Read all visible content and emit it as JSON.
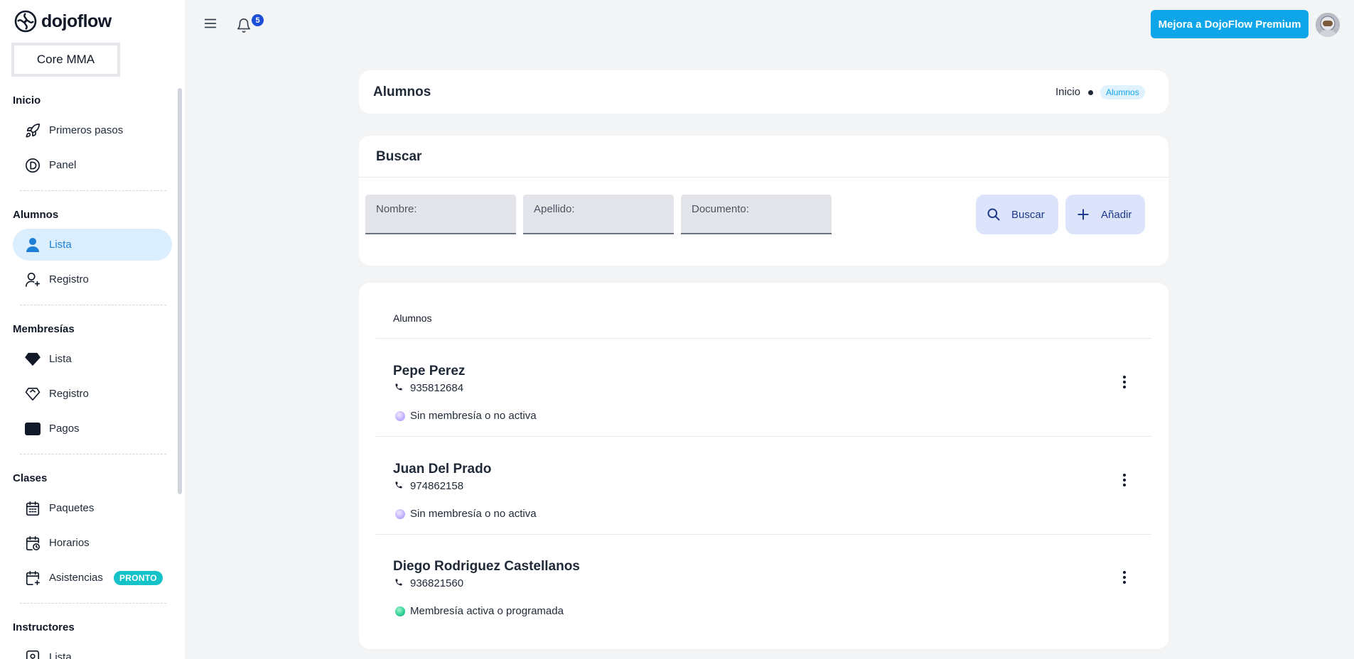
{
  "app": {
    "brand": "dojoflow",
    "org_name": "Core MMA"
  },
  "sidebar": {
    "sections": {
      "inicio": "Inicio",
      "alumnos": "Alumnos",
      "membresias": "Membresías",
      "clases": "Clases",
      "instructores": "Instructores"
    },
    "items": {
      "primeros_pasos": "Primeros pasos",
      "panel": "Panel",
      "alumnos_lista": "Lista",
      "alumnos_registro": "Registro",
      "membresias_lista": "Lista",
      "membresias_registro": "Registro",
      "pagos": "Pagos",
      "paquetes": "Paquetes",
      "horarios": "Horarios",
      "asistencias": "Asistencias",
      "instructores_lista": "Lista"
    },
    "asistencias_badge": "PRONTO"
  },
  "topbar": {
    "notifications_count": "5",
    "premium_button": "Mejora a DojoFlow Premium"
  },
  "header": {
    "title": "Alumnos",
    "breadcrumb_home": "Inicio",
    "breadcrumb_current": "Alumnos"
  },
  "search": {
    "title": "Buscar",
    "nombre_placeholder": "Nombre:",
    "apellido_placeholder": "Apellido:",
    "documento_placeholder": "Documento:",
    "search_button": "Buscar",
    "add_button": "Añadir"
  },
  "list": {
    "heading": "Alumnos",
    "students": [
      {
        "name": "Pepe Perez",
        "phone": "935812684",
        "status": "Sin membresía o no activa"
      },
      {
        "name": "Juan Del Prado",
        "phone": "974862158",
        "status": "Sin membresía o no activa"
      },
      {
        "name": "Diego Rodriguez Castellanos",
        "phone": "936821560",
        "status": "Membresía activa o programada"
      }
    ]
  },
  "colors": {
    "accent": "#0ea5e9",
    "active_nav_bg": "#dbeefe",
    "badge": "#14c3c7",
    "status_inactive": "#c4b5fd",
    "status_active": "#34d399"
  }
}
